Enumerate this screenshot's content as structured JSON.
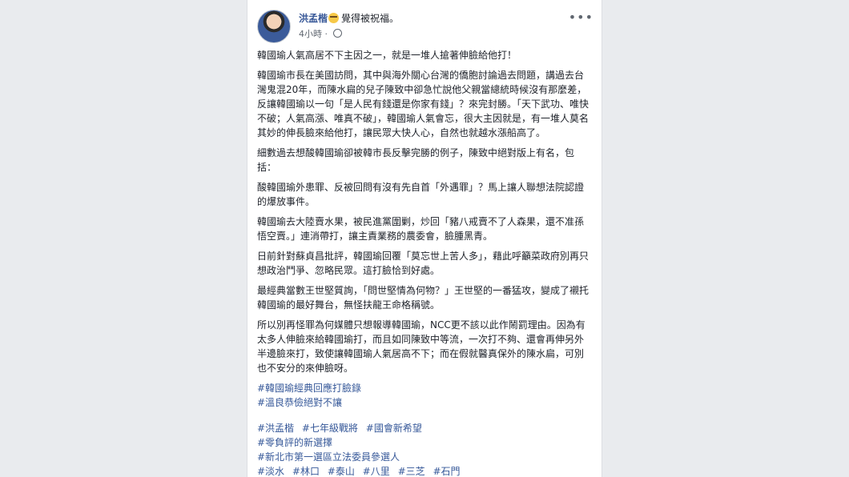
{
  "post": {
    "author": "洪孟楷",
    "feeling": "覺得被祝福。",
    "time": "4小時",
    "dot": "·",
    "more_icon": "more-horizontal-icon",
    "paragraphs": [
      "韓國瑜人氣高居不下主因之一，就是一堆人搶著伸臉給他打！",
      "韓國瑜市長在美國訪問，其中與海外關心台灣的僑胞討論過去問題，講過去台灣鬼混20年，而陳水扁的兒子陳致中卻急忙說他父親當總統時候沒有那麼差，反讓韓國瑜以一句「是人民有錢還是你家有錢」？來完封勝。「天下武功、唯快不破；人氣高漲、唯真不破」，韓國瑜人氣會忘，很大主因就是，有一堆人莫名其妙的伸長臉來給他打，讓民眾大快人心，自然也就越水漲船高了。",
      "細數過去想酸韓國瑜卻被韓市長反擊完勝的例子，陳致中絕對版上有名，包括：",
      "酸韓國瑜外患罪、反被回問有沒有先自首「外遇罪」？馬上讓人聯想法院認證的爆放事件。",
      "韓國瑜去大陸賣水果，被民進黨圍剿，炒回「豬八戒賣不了人森果，還不准孫悟空賣。」連消帶打，讓主責業務的農委會，臉腫黑青。",
      "日前針對蘇貞昌批評，韓國瑜回覆「莫忘世上苦人多」，藉此呼籲菜政府別再只想政治鬥爭、忽略民眾。這打臉恰到好處。",
      "最經典當數王世堅質詢，「問世堅情為何物？」王世堅的一番猛攻，變成了襯托韓國瑜的最好舞台，無怪扶龍王命格稱號。",
      "所以別再怪罪為何媒體只想報導韓國瑜，NCC更不該以此作鬧罰理由。因為有太多人伸臉來給韓國瑜打，而且如同陳致中等流，一次打不夠、還會再伸另外半邊臉來打，致使讓韓國瑜人氣居高不下；而在假就醫真保外的陳水扁，可別也不安分的來伸臉呀。"
    ],
    "tag_group_1": [
      "#韓國瑜經典回應打臉錄",
      "#溫良恭儉絕對不讓"
    ],
    "tag_group_2": [
      [
        "#洪孟楷",
        "#七年級戰將",
        "#國會新希望"
      ],
      [
        "#零負評的新選擇"
      ],
      [
        "#新北市第一選區立法委員參選人"
      ],
      [
        "#淡水",
        "#林口",
        "#泰山",
        "#八里",
        "#三芝",
        "#石門"
      ]
    ]
  }
}
